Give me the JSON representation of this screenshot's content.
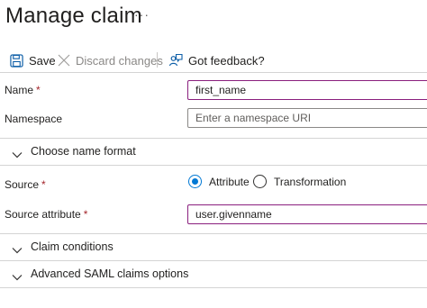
{
  "page": {
    "title": "Manage claim",
    "more_label": "···"
  },
  "toolbar": {
    "save_label": "Save",
    "discard_label": "Discard changes",
    "feedback_label": "Got feedback?"
  },
  "form": {
    "name": {
      "label": "Name",
      "required_mark": "*",
      "value": "first_name"
    },
    "namespace": {
      "label": "Namespace",
      "placeholder": "Enter a namespace URI"
    },
    "name_format_section": "Choose name format",
    "source": {
      "label": "Source",
      "required_mark": "*",
      "options": [
        "Attribute",
        "Transformation"
      ],
      "selected": "Attribute"
    },
    "source_attribute": {
      "label": "Source attribute",
      "required_mark": "*",
      "value": "user.givenname"
    },
    "claim_conditions_section": "Claim conditions",
    "advanced_saml_section": "Advanced SAML claims options"
  },
  "colors": {
    "accent": "#0078d4",
    "focus_border": "#8a1f7e",
    "required": "#a4262c",
    "disabled_text": "#8a8886"
  },
  "icons": [
    "more-icon",
    "save-icon",
    "discard-icon",
    "feedback-icon",
    "chevron-down-icon"
  ]
}
